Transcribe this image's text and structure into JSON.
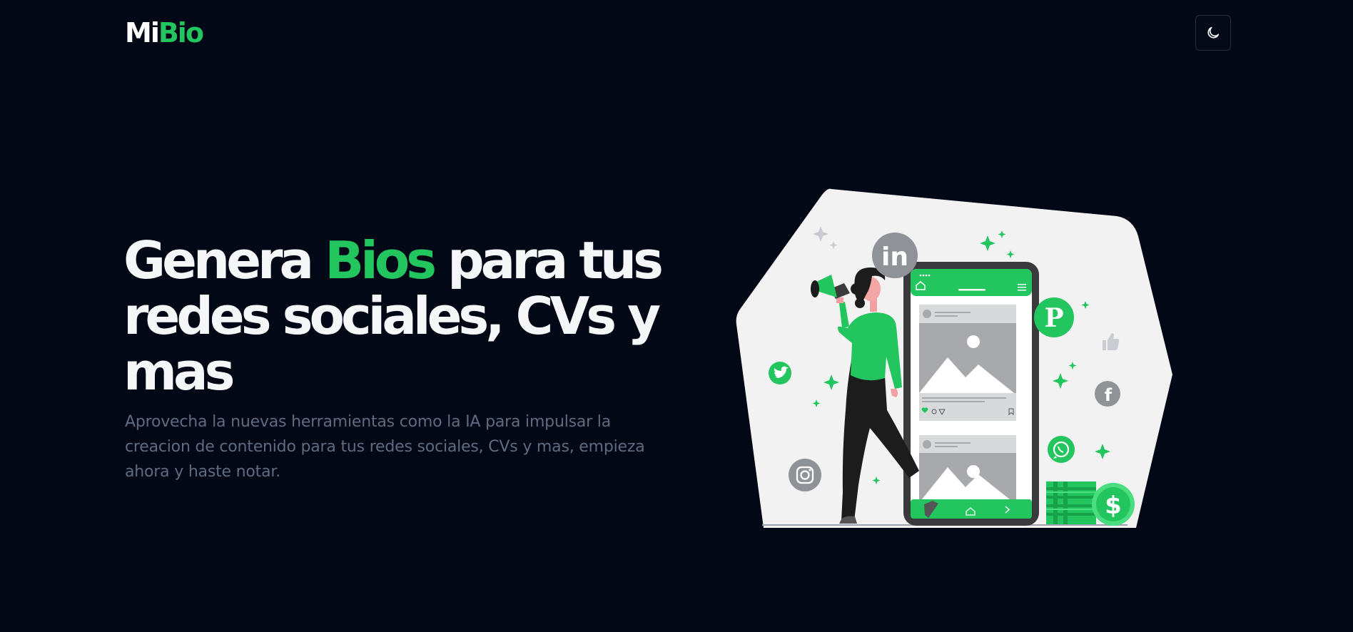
{
  "header": {
    "logo_part1": "Mi",
    "logo_part2": "Bio",
    "theme_toggle_icon": "moon-icon"
  },
  "hero": {
    "title_part1": "Genera ",
    "title_highlight": "Bios",
    "title_part2": " para tus redes sociales, CVs y mas",
    "subtitle": "Aprovecha la nuevas herramientas como la IA para impulsar la creacion de contenido para tus redes sociales, CVs y mas, empieza ahora y haste notar."
  },
  "illustration": {
    "social_icons": [
      "linkedin-icon",
      "pinterest-icon",
      "twitter-icon",
      "facebook-icon",
      "whatsapp-icon",
      "instagram-icon",
      "thumbs-up-icon"
    ],
    "money_symbol": "$"
  },
  "colors": {
    "background": "#030816",
    "accent": "#22c55e",
    "title": "#f5f6f8",
    "subtitle": "#5f6b80"
  }
}
